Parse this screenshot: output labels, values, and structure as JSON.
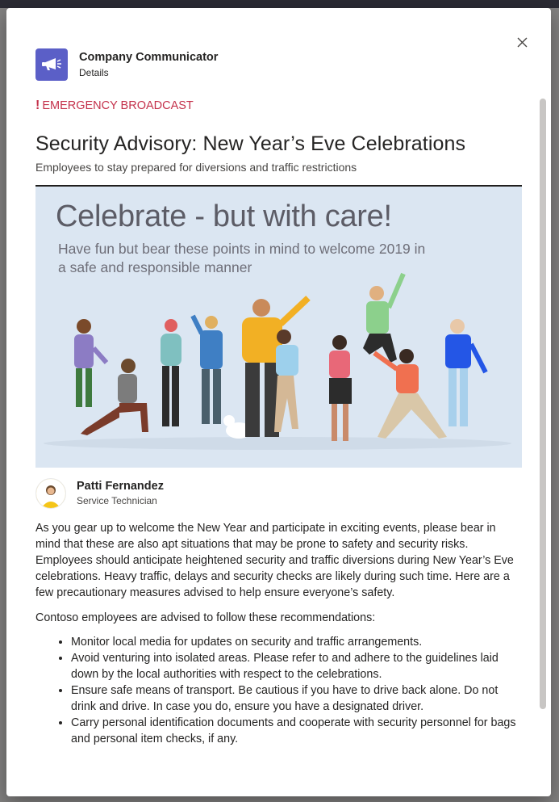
{
  "app": {
    "name": "Company Communicator",
    "subtitle": "Details"
  },
  "card": {
    "importance": "EMERGENCY BROADCAST",
    "title": "Security Advisory: New Year’s Eve Celebrations",
    "summary": "Employees to stay prepared for diversions and traffic restrictions",
    "hero": {
      "headline": "Celebrate - but with care!",
      "subline": "Have fun but bear these points in mind to welcome 2019 in a safe and responsible manner"
    },
    "author": {
      "name": "Patti Fernandez",
      "role": "Service Technician"
    },
    "body_paragraph": "As you gear up to welcome the New Year and participate in exciting events, please bear in mind that these are also apt situations that may be prone to safety and security risks. Employees should anticipate heightened security and traffic diversions during New Year’s Eve celebrations. Heavy traffic, delays and security checks are likely during such time. Here are a few precautionary measures advised to help ensure everyone’s safety.",
    "recommendations_intro": "Contoso employees are advised to follow these recommendations:",
    "recommendations": [
      "Monitor local media for updates on security and traffic arrangements.",
      "Avoid venturing into isolated areas. Please refer to and adhere to the guidelines laid down by the local authorities with respect to the celebrations.",
      "Ensure safe means of transport. Be cautious if you have to drive back alone. Do not drink and drive. In case you do, ensure you have a designated driver.",
      "Carry personal identification documents and cooperate with security personnel for bags and personal item checks, if any."
    ]
  },
  "icons": {
    "close": "close-icon",
    "app": "megaphone-icon",
    "importance": "exclamation-icon"
  },
  "colors": {
    "accent": "#5b5fc7",
    "emergency": "#c4314b",
    "hero_background": "#dbe6f2"
  }
}
